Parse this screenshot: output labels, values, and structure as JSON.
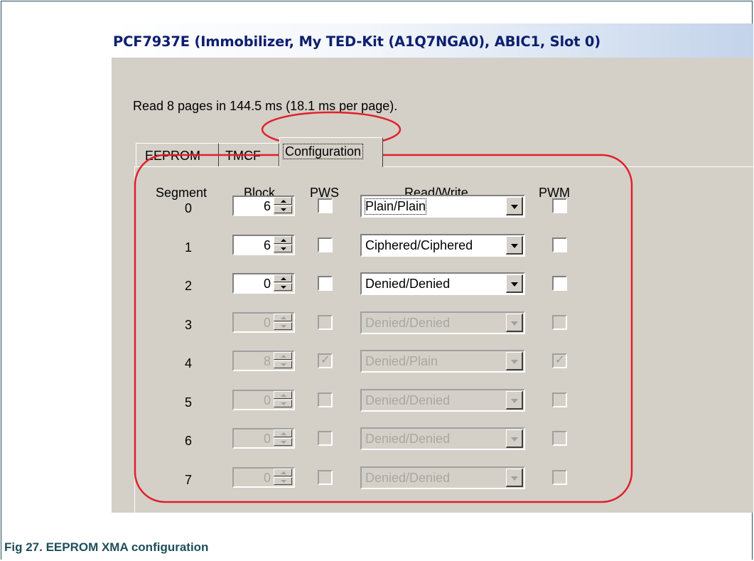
{
  "window": {
    "title": "PCF7937E (Immobilizer, My TED-Kit (A1Q7NGA0), ABIC1, Slot 0)",
    "status": "Read 8 pages in 144.5 ms (18.1 ms per page)."
  },
  "tabs": [
    {
      "label": "EEPROM"
    },
    {
      "label": "TMCF"
    },
    {
      "label": "Configuration",
      "selected": true
    }
  ],
  "headers": {
    "segment": "Segment",
    "block": "Block",
    "pws": "PWS",
    "read_write": "Read/Write",
    "pwm": "PWM"
  },
  "rows": [
    {
      "segment": "0",
      "block": "6",
      "pws": false,
      "read_write": "Plain/Plain",
      "pwm": false,
      "enabled": true
    },
    {
      "segment": "1",
      "block": "6",
      "pws": false,
      "read_write": "Ciphered/Ciphered",
      "pwm": false,
      "enabled": true
    },
    {
      "segment": "2",
      "block": "0",
      "pws": false,
      "read_write": "Denied/Denied",
      "pwm": false,
      "enabled": true
    },
    {
      "segment": "3",
      "block": "0",
      "pws": false,
      "read_write": "Denied/Denied",
      "pwm": false,
      "enabled": false
    },
    {
      "segment": "4",
      "block": "8",
      "pws": true,
      "read_write": "Denied/Plain",
      "pwm": true,
      "enabled": false
    },
    {
      "segment": "5",
      "block": "0",
      "pws": false,
      "read_write": "Denied/Denied",
      "pwm": false,
      "enabled": false
    },
    {
      "segment": "6",
      "block": "0",
      "pws": false,
      "read_write": "Denied/Denied",
      "pwm": false,
      "enabled": false
    },
    {
      "segment": "7",
      "block": "0",
      "pws": false,
      "read_write": "Denied/Denied",
      "pwm": false,
      "enabled": false
    }
  ],
  "caption": "Fig 27.   EEPROM XMA configuration",
  "colors": {
    "title_text": "#0d1f6e",
    "caption_text": "#1f4e5a",
    "annotation": "#e0202a",
    "window_bg": "#d4d0c8"
  }
}
